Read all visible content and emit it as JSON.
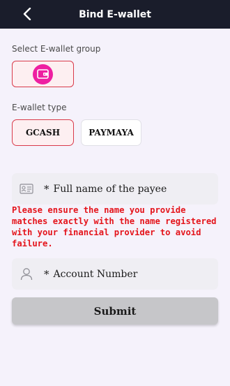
{
  "header": {
    "title": "Bind E-wallet",
    "back_icon": "chevron-left-icon"
  },
  "wallet_group": {
    "label": "Select E-wallet group",
    "selected_icon": "wallet-icon",
    "accent_color": "#ee1fa1"
  },
  "wallet_type": {
    "label": "E-wallet type",
    "options": [
      {
        "label": "GCASH",
        "selected": true
      },
      {
        "label": "PAYMAYA",
        "selected": false
      }
    ]
  },
  "payee_field": {
    "icon": "id-card-icon",
    "required_mark": "*",
    "placeholder": "Full name of the payee"
  },
  "warning": {
    "text": "Please ensure the name you provide matches exactly with the name registered with your financial provider to avoid failure.",
    "color": "#e4141b"
  },
  "account_field": {
    "icon": "user-icon",
    "required_mark": "*",
    "placeholder": "Account Number"
  },
  "submit": {
    "label": "Submit"
  },
  "colors": {
    "header_bg": "#1a1d2b",
    "page_bg": "#f5f2fb",
    "selected_border": "#d93a4a"
  }
}
